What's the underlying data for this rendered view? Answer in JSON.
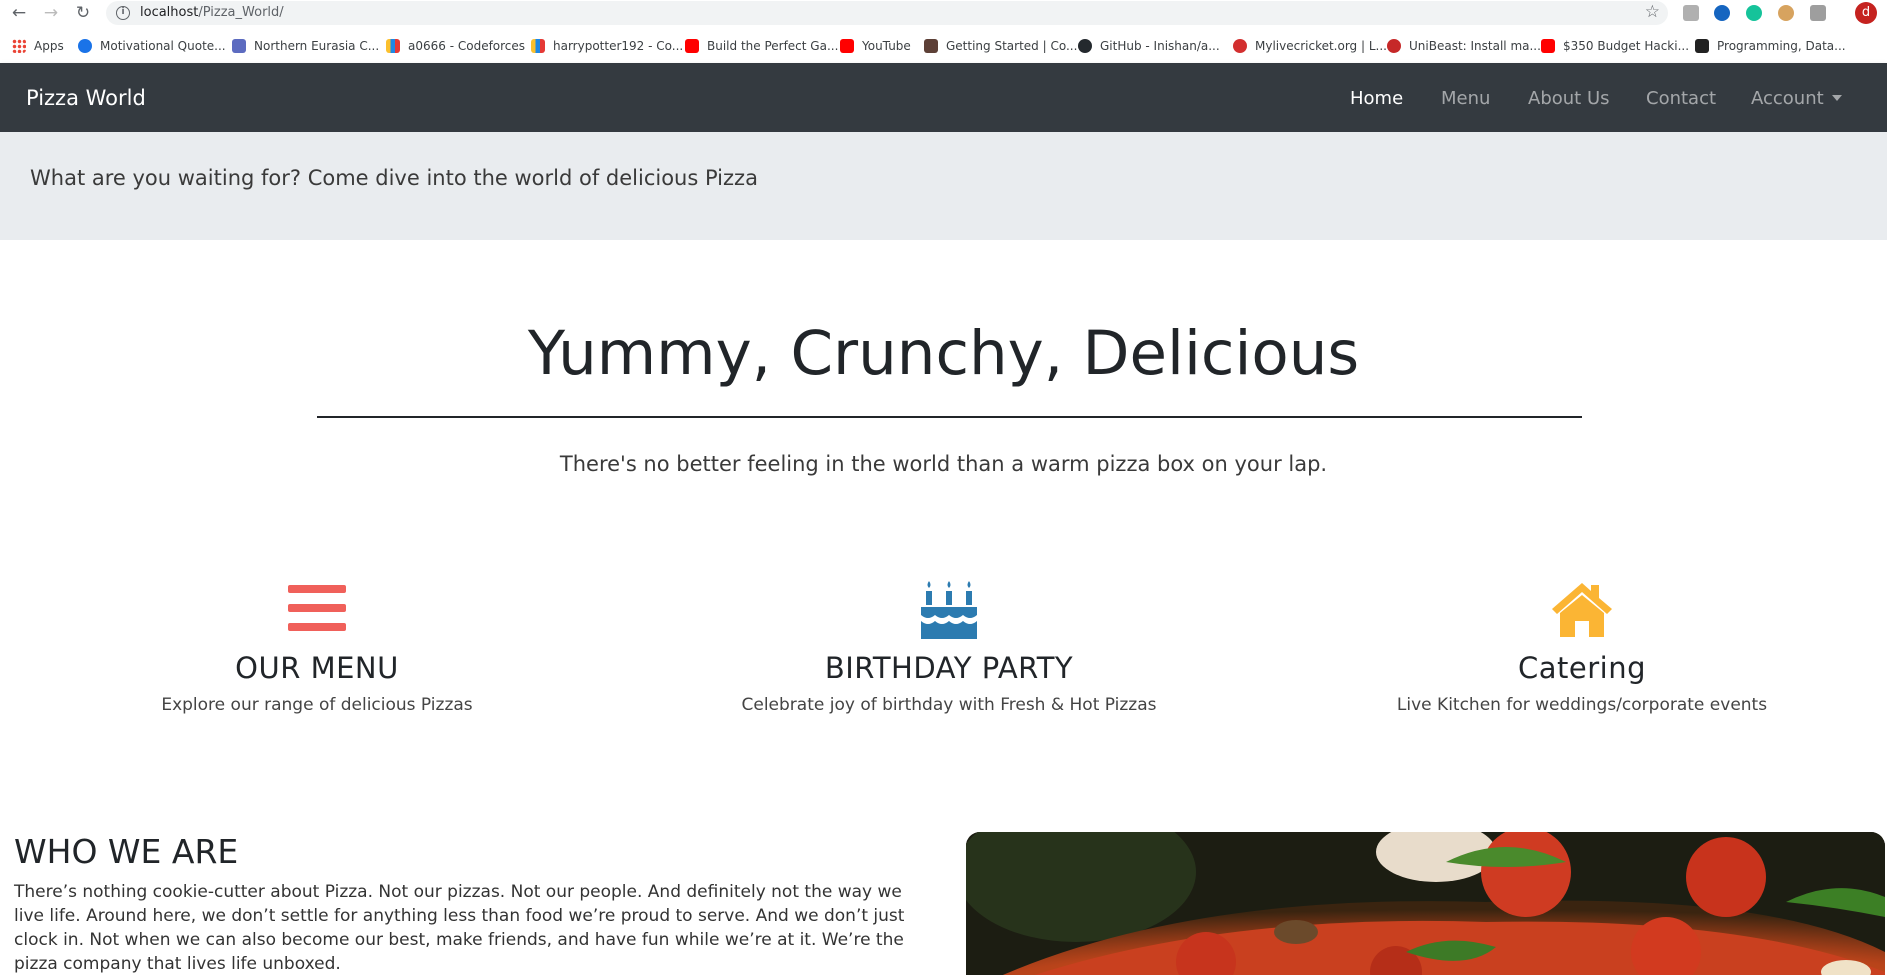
{
  "browser": {
    "url_host": "localhost",
    "url_path": "/Pizza_World/",
    "profile_initial": "d",
    "bookmarks": [
      {
        "label": "Apps",
        "color": "#4285f4"
      },
      {
        "label": "Motivational Quote...",
        "color": "#1a73e8"
      },
      {
        "label": "Northern Eurasia C...",
        "color": "#5c6bc0"
      },
      {
        "label": "a0666 - Codeforces",
        "color": "#1e88e5"
      },
      {
        "label": "harrypotter192 - Co...",
        "color": "#1e88e5"
      },
      {
        "label": "Build the Perfect Ga...",
        "color": "#ff0000"
      },
      {
        "label": "YouTube",
        "color": "#ff0000"
      },
      {
        "label": "Getting Started | Co...",
        "color": "#5d4037"
      },
      {
        "label": "GitHub - Inishan/a...",
        "color": "#24292e"
      },
      {
        "label": "Mylivecricket.org | L...",
        "color": "#d32f2f"
      },
      {
        "label": "UniBeast: Install ma...",
        "color": "#c62828"
      },
      {
        "label": "$350 Budget Hacki...",
        "color": "#ff0000"
      },
      {
        "label": "Programming, Data...",
        "color": "#222222"
      }
    ]
  },
  "navbar": {
    "brand": "Pizza World",
    "links": [
      {
        "label": "Home",
        "active": true
      },
      {
        "label": "Menu",
        "active": false
      },
      {
        "label": "About Us",
        "active": false
      },
      {
        "label": "Contact",
        "active": false
      },
      {
        "label": "Account",
        "active": false,
        "dropdown": true
      }
    ]
  },
  "jumbotron": {
    "text": "What are you waiting for? Come dive into the world of delicious Pizza"
  },
  "hero": {
    "title": "Yummy, Crunchy, Delicious",
    "tagline": "There's no better feeling in the world than a warm pizza box on your lap."
  },
  "features": [
    {
      "icon": "menu-bars-icon",
      "color": "#f0605a",
      "title": "OUR MENU",
      "text": "Explore our range of delicious Pizzas"
    },
    {
      "icon": "birthday-cake-icon",
      "color": "#2c7bb0",
      "title": "BIRTHDAY PARTY",
      "text": "Celebrate joy of birthday with Fresh & Hot Pizzas"
    },
    {
      "icon": "home-icon",
      "color": "#fbb534",
      "title": "Catering",
      "text": "Live Kitchen for weddings/corporate events"
    }
  ],
  "who": {
    "title": "WHO WE ARE",
    "text": "There’s nothing cookie-cutter about Pizza. Not our pizzas. Not our people. And definitely not the way we live life. Around here, we don’t settle for anything less than food we’re proud to serve. And we don’t just clock in. Not when we can also become our best, make friends, and have fun while we’re at it. We’re the pizza company that lives life unboxed."
  }
}
